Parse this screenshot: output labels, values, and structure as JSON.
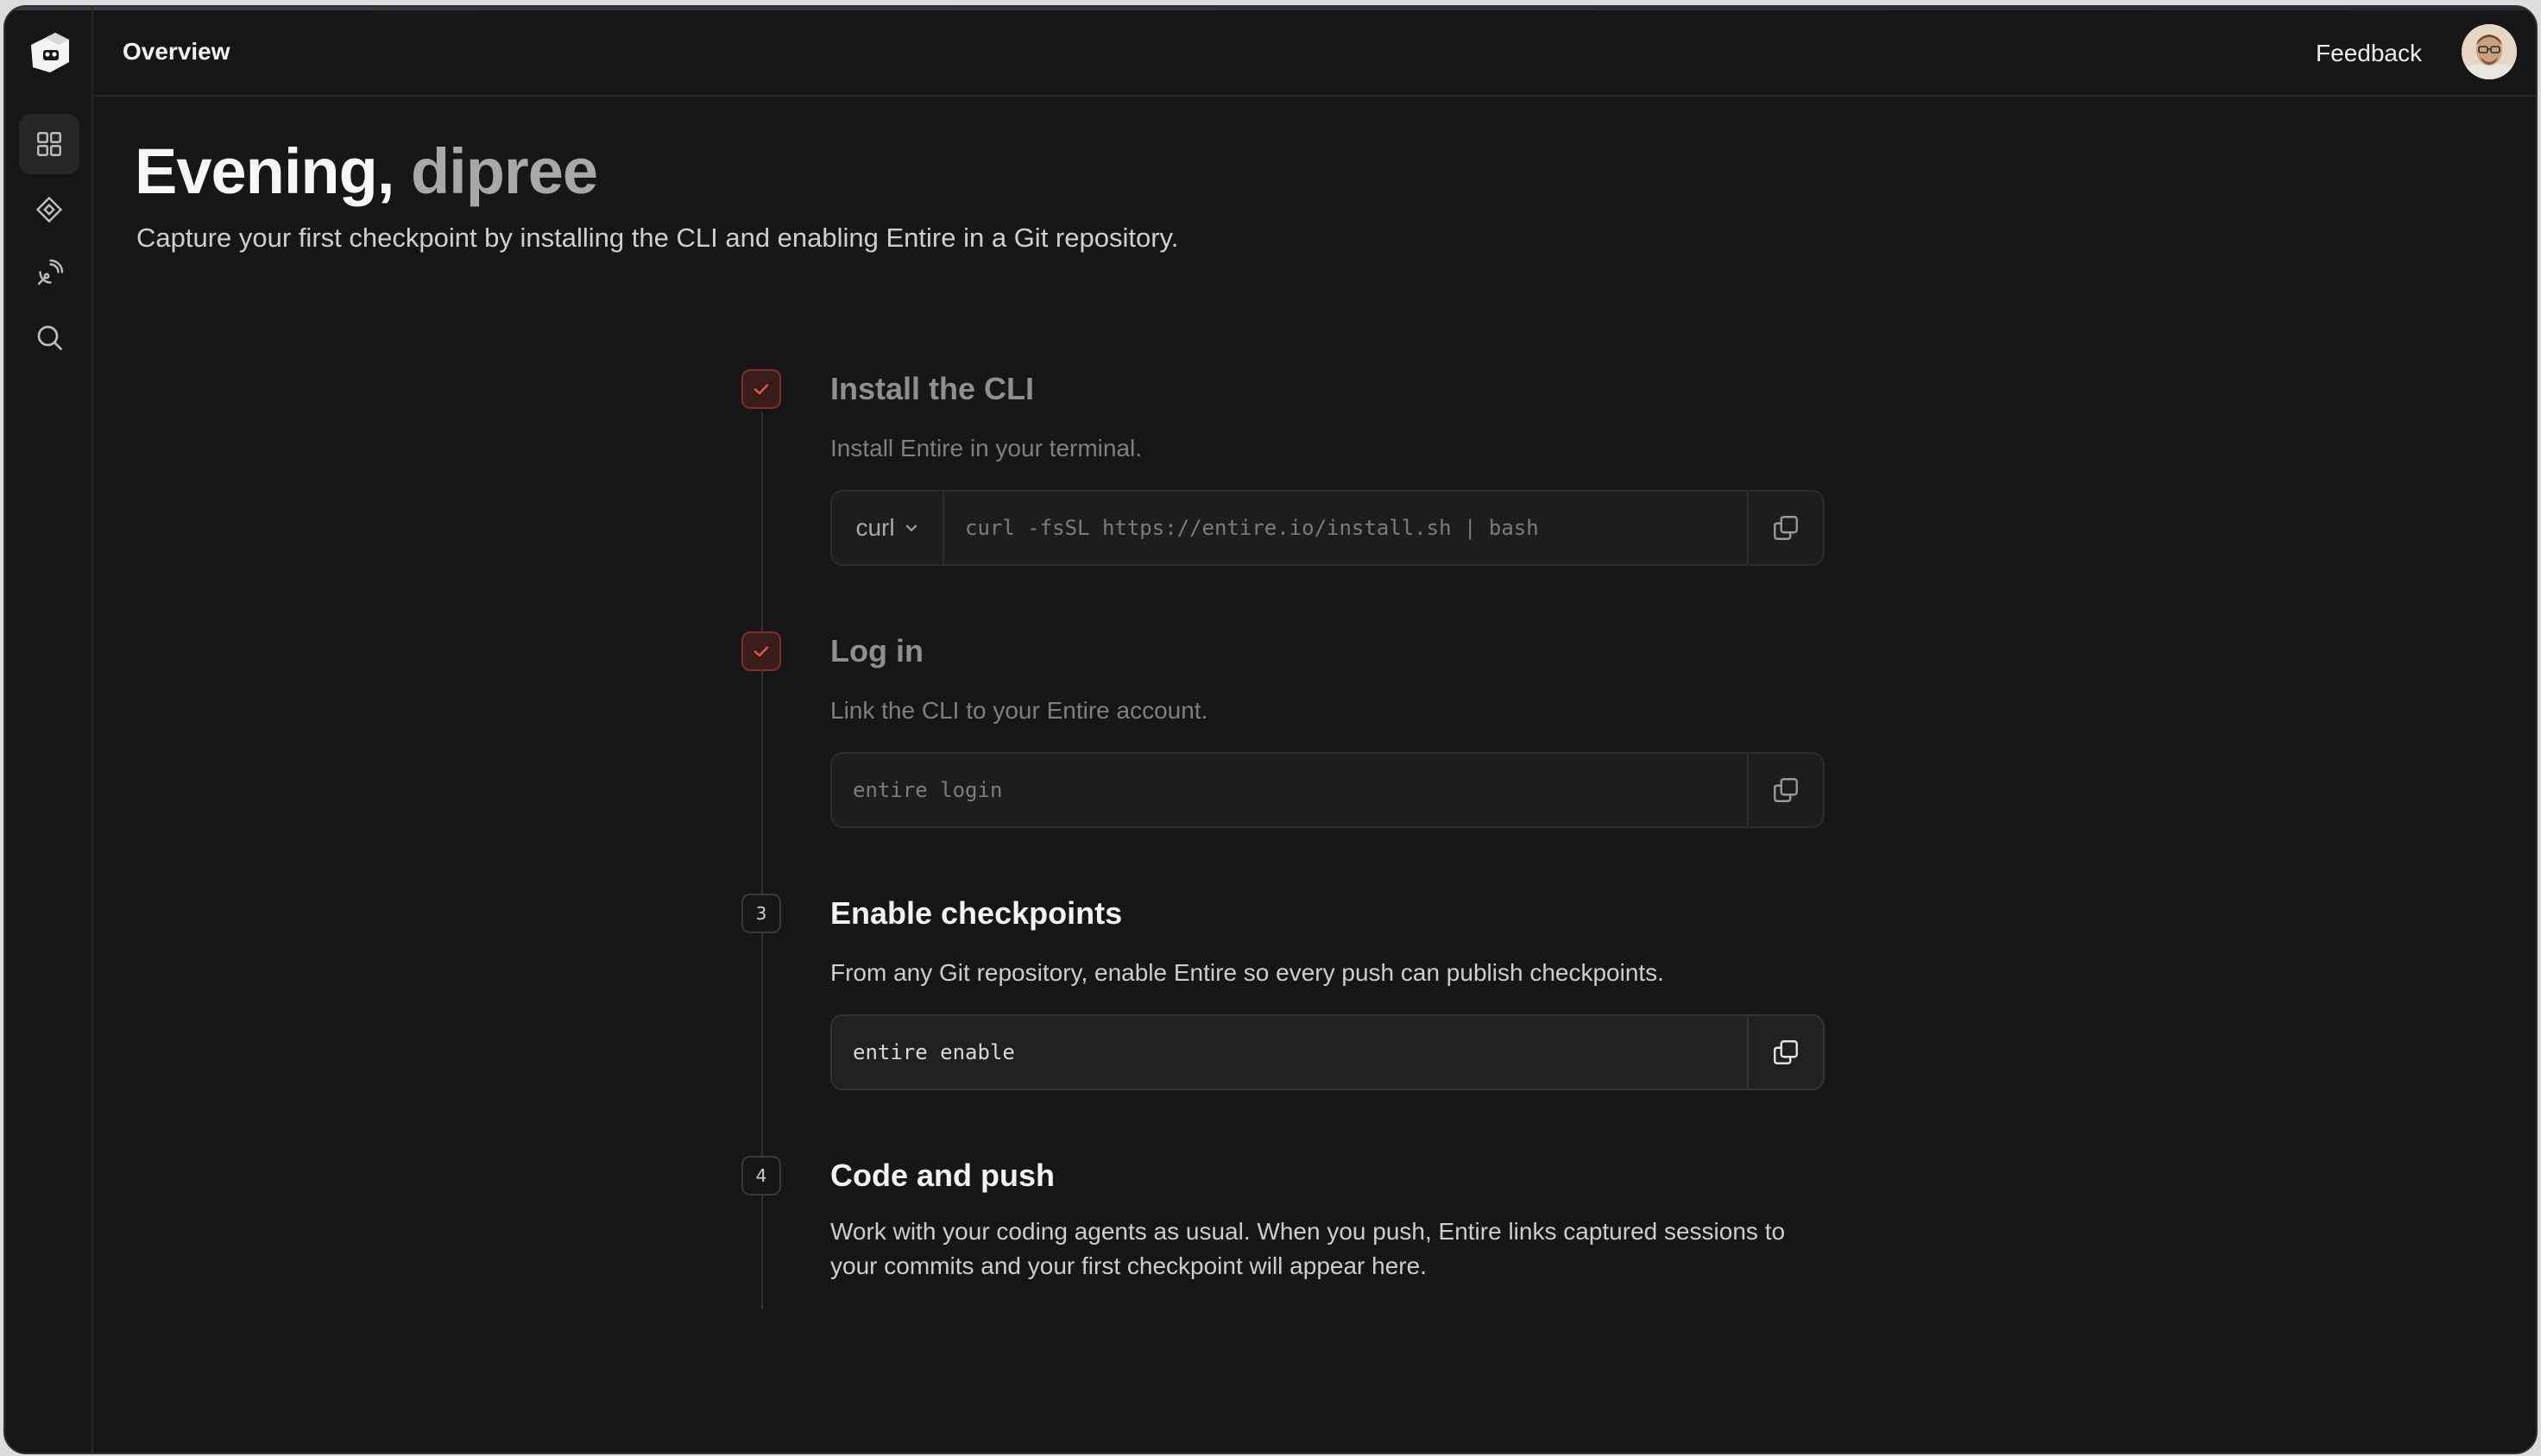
{
  "topbar": {
    "title": "Overview",
    "feedback_label": "Feedback"
  },
  "sidebar": {
    "items": [
      {
        "name": "overview",
        "icon": "grid-icon",
        "active": true
      },
      {
        "name": "diamond",
        "icon": "diamond-icon",
        "active": false
      },
      {
        "name": "activity",
        "icon": "satellite-icon",
        "active": false
      },
      {
        "name": "search",
        "icon": "search-icon",
        "active": false
      }
    ]
  },
  "greeting": {
    "prefix": "Evening,",
    "username": "dipree",
    "subtitle": "Capture your first checkpoint by installing the CLI and enabling Entire in a Git repository."
  },
  "steps": [
    {
      "status": "done",
      "title": "Install the CLI",
      "description": "Install Entire in your terminal.",
      "method": "curl",
      "command": "curl -fsSL https://entire.io/install.sh | bash"
    },
    {
      "status": "done",
      "title": "Log in",
      "description": "Link the CLI to your Entire account.",
      "command": "entire login"
    },
    {
      "status": "pending",
      "number": "3",
      "title": "Enable checkpoints",
      "description": "From any Git repository, enable Entire so every push can publish checkpoints.",
      "command": "entire enable"
    },
    {
      "status": "pending",
      "number": "4",
      "title": "Code and push",
      "description": "Work with your coding agents as usual. When you push, Entire links captured sessions to your commits and your first checkpoint will appear here."
    }
  ],
  "colors": {
    "background": "#161616",
    "accent_red": "#e0564b",
    "check_fill": "#3a1d1b"
  }
}
